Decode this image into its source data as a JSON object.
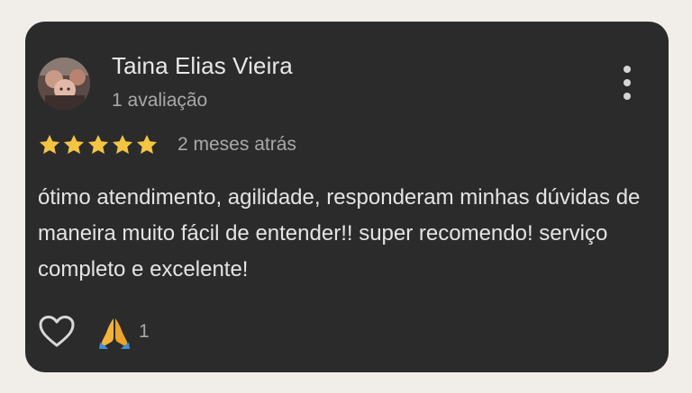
{
  "review": {
    "author_name": "Taina Elias Vieira",
    "author_reviews": "1 avaliação",
    "rating": 5,
    "rating_max": 5,
    "date": "2 meses atrás",
    "text": "ótimo atendimento, agilidade, responderam minhas dúvidas de maneira muito fácil de entender!! super recomendo! serviço completo e excelente!",
    "reaction_emoji": "praying-hands-emoji",
    "reaction_count": "1"
  },
  "icons": {
    "more": "more-vert-icon",
    "like": "heart-outline-icon",
    "star": "star-icon"
  },
  "colors": {
    "background": "#f1eeea",
    "card": "#2b2b2c",
    "star": "#f4c542",
    "primary_text": "#e8e8e8",
    "secondary_text": "#a9a9a9"
  }
}
